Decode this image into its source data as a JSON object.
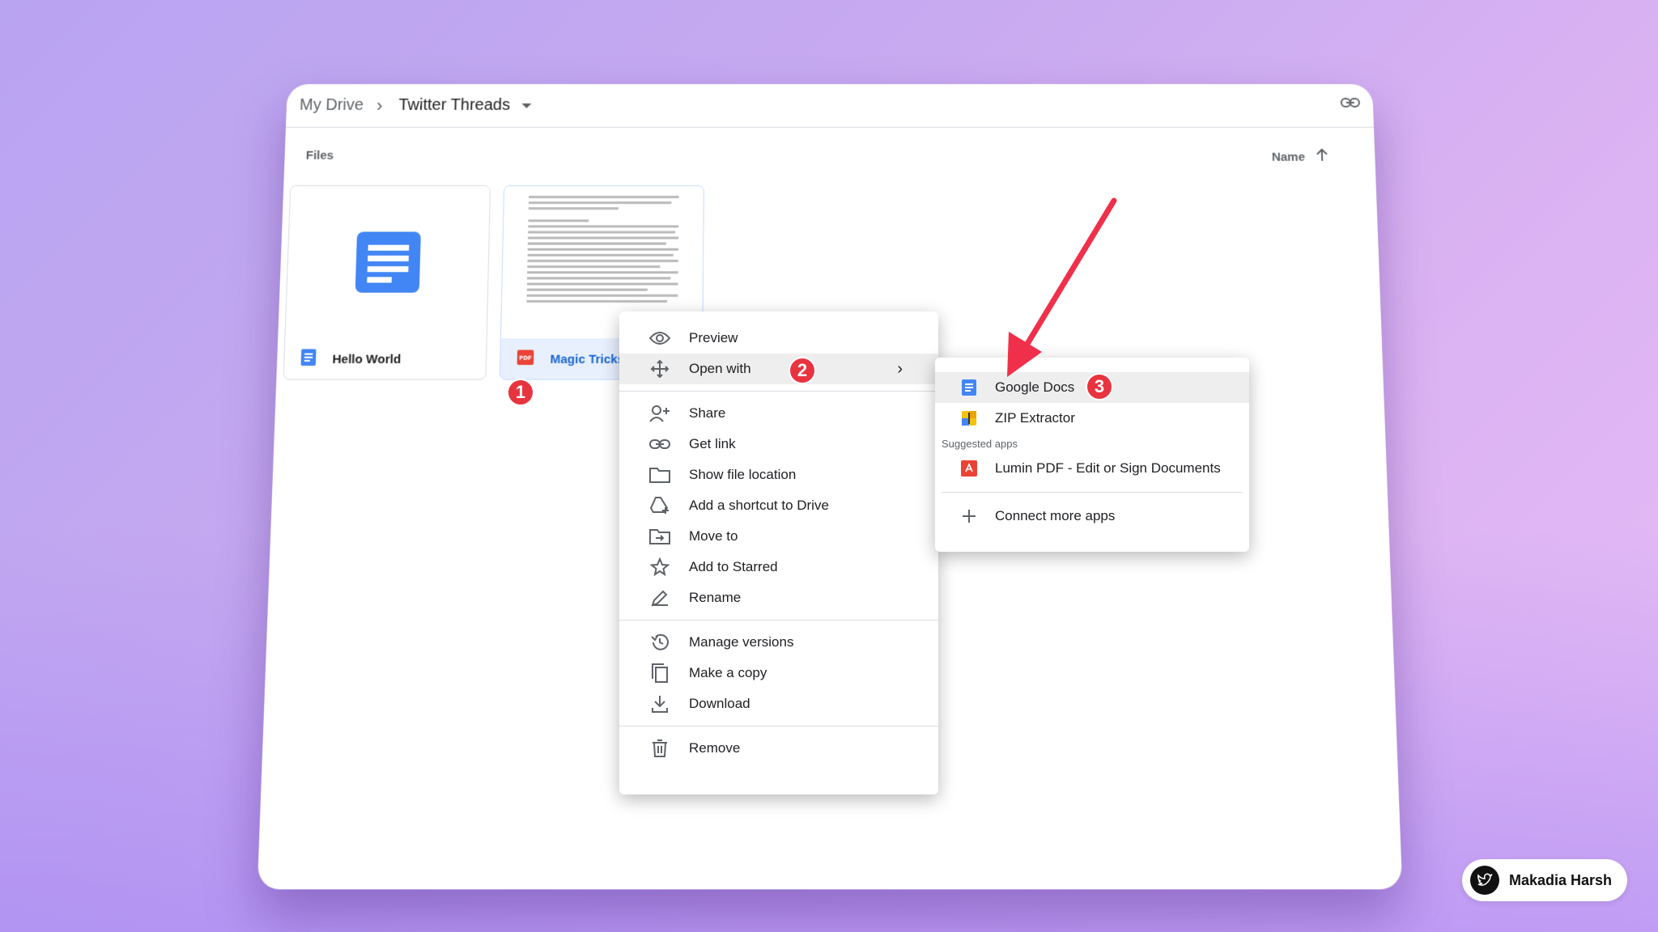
{
  "breadcrumb": {
    "root": "My Drive",
    "current": "Twitter Threads"
  },
  "section_label": "Files",
  "sort": {
    "label": "Name"
  },
  "files": [
    {
      "name": "Hello World",
      "type": "doc"
    },
    {
      "name": "Magic Tricks",
      "type": "pdf",
      "type_label": "PDF"
    }
  ],
  "context_menu": {
    "items": [
      {
        "label": "Preview",
        "icon": "eye-icon"
      },
      {
        "label": "Open with",
        "icon": "move-arrows-icon"
      },
      {
        "label": "Share",
        "icon": "person-add-icon"
      },
      {
        "label": "Get link",
        "icon": "link-icon"
      },
      {
        "label": "Show file location",
        "icon": "folder-icon"
      },
      {
        "label": "Add a shortcut to Drive",
        "icon": "drive-shortcut-icon"
      },
      {
        "label": "Move to",
        "icon": "folder-move-icon"
      },
      {
        "label": "Add to Starred",
        "icon": "star-icon"
      },
      {
        "label": "Rename",
        "icon": "pencil-icon"
      },
      {
        "label": "Manage versions",
        "icon": "history-icon"
      },
      {
        "label": "Make a copy",
        "icon": "copy-icon"
      },
      {
        "label": "Download",
        "icon": "download-icon"
      },
      {
        "label": "Remove",
        "icon": "trash-icon"
      }
    ]
  },
  "submenu": {
    "google_docs": "Google Docs",
    "zip_extractor": "ZIP Extractor",
    "suggested_label": "Suggested apps",
    "lumin": "Lumin PDF - Edit or Sign Documents",
    "connect": "Connect more apps"
  },
  "badges": [
    "1",
    "2",
    "3"
  ],
  "author": {
    "name": "Makadia Harsh"
  },
  "colors": {
    "badge": "#e8343f",
    "docs_blue": "#4285f4",
    "pdf_red": "#ea4335",
    "arrow": "#f0304a"
  }
}
